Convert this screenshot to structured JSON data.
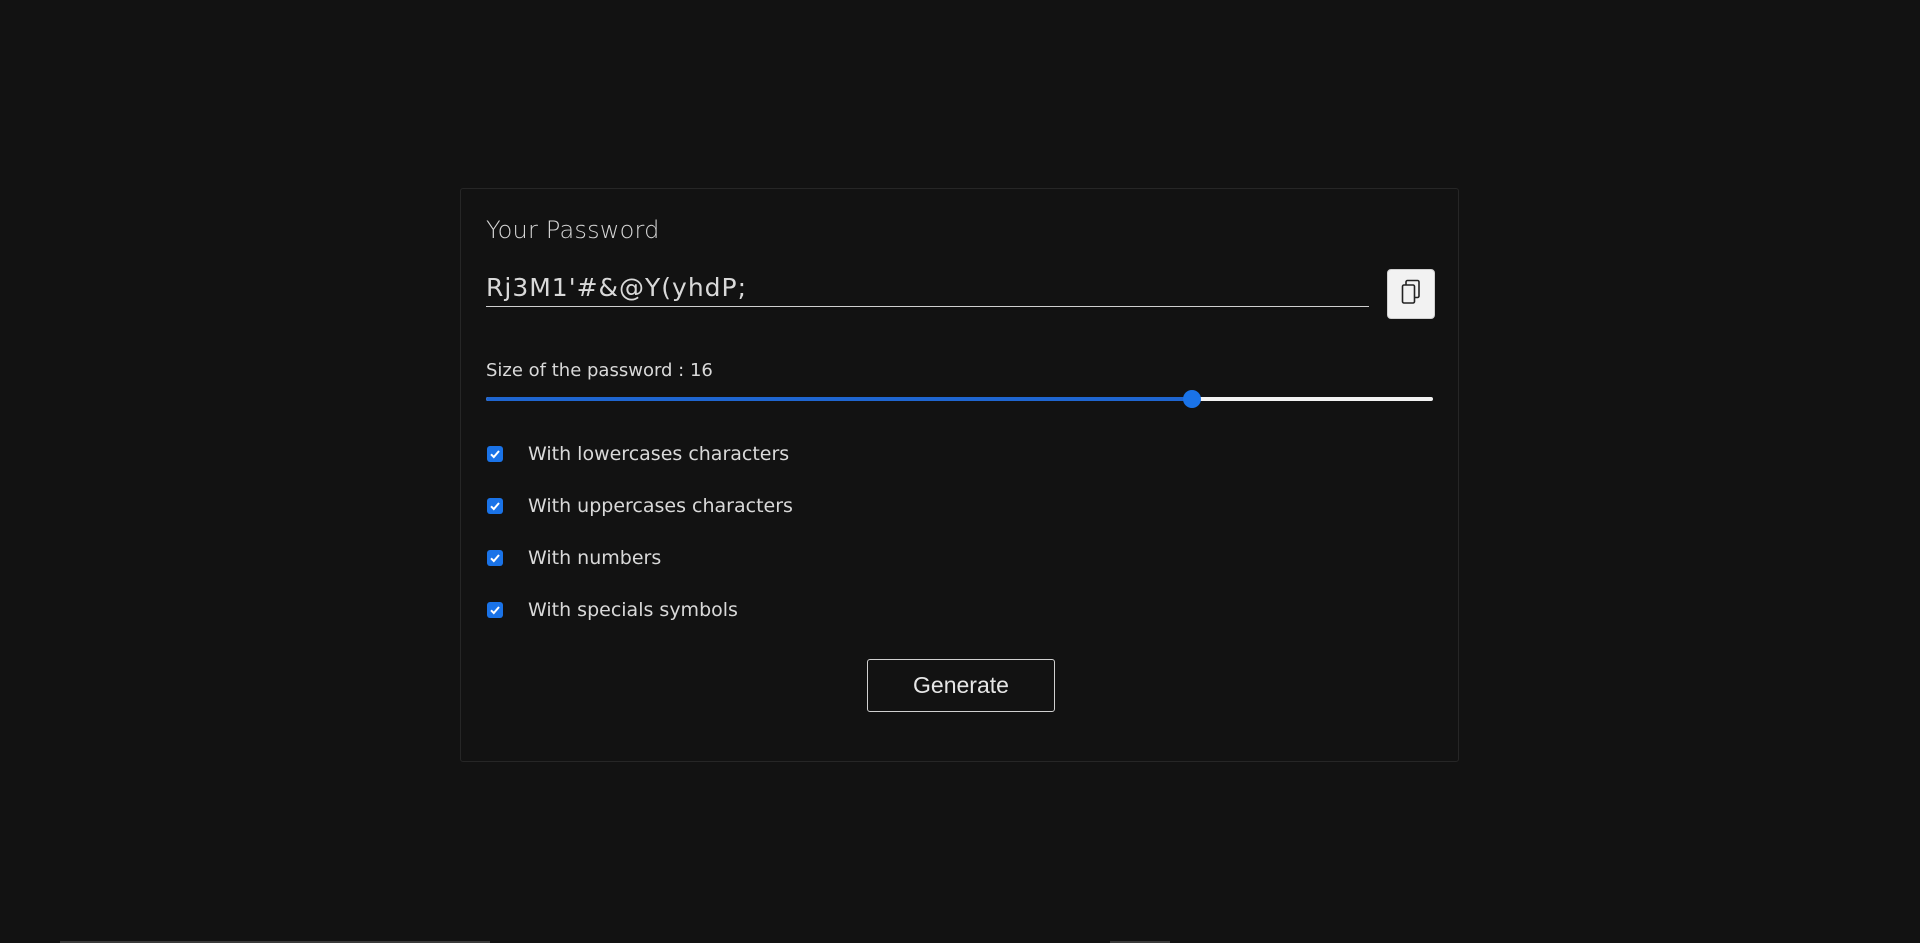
{
  "card": {
    "title": "Your Password",
    "password_value": "Rj3M1'#&@Y(yhdP;"
  },
  "copy_button": {
    "icon": "copy-icon"
  },
  "size": {
    "label": "Size of the password : 16",
    "value": 16,
    "slider_fraction": 0.746
  },
  "options": [
    {
      "label": "With lowercases characters",
      "checked": true
    },
    {
      "label": "With uppercases characters",
      "checked": true
    },
    {
      "label": "With numbers",
      "checked": true
    },
    {
      "label": "With specials symbols",
      "checked": true
    }
  ],
  "generate_button": {
    "label": "Generate"
  },
  "colors": {
    "background": "#121212",
    "accent": "#1a73e8",
    "text": "#d9d9d9"
  }
}
